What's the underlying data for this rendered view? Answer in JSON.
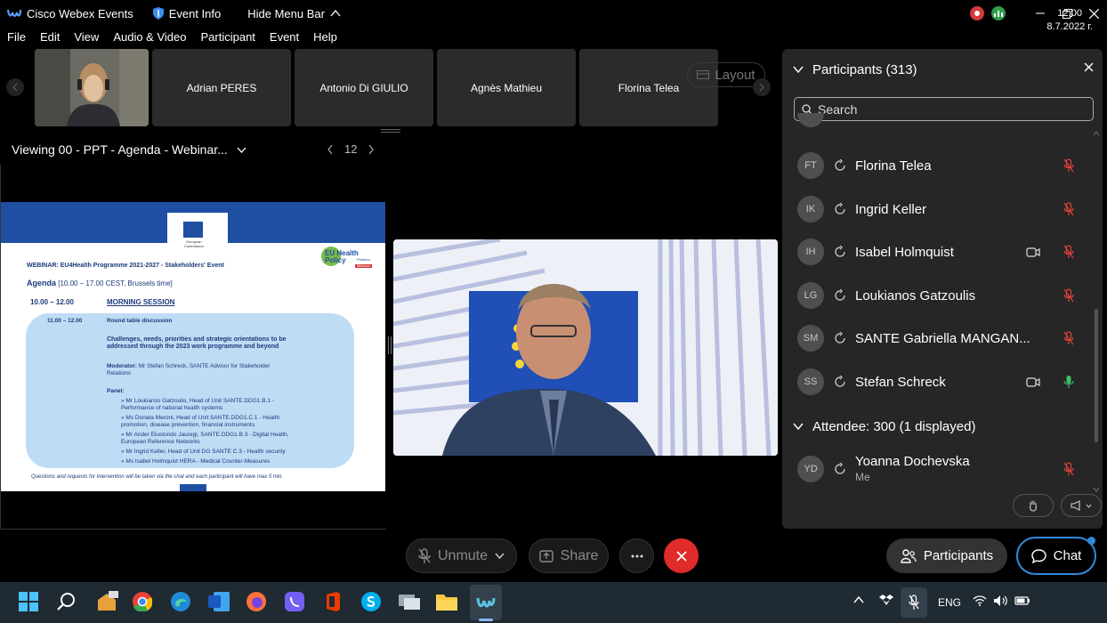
{
  "titlebar": {
    "app_name": "Cisco Webex Events",
    "event_info": "Event Info",
    "hide_menu": "Hide Menu Bar"
  },
  "menu": [
    "File",
    "Edit",
    "View",
    "Audio & Video",
    "Participant",
    "Event",
    "Help"
  ],
  "video_strip": {
    "tiles": [
      "Adrian PERES",
      "Antonio Di GIULIO",
      "Agnès Mathieu",
      "Florina Telea"
    ],
    "layout_label": "Layout"
  },
  "viewing": {
    "label": "Viewing 00 - PPT - Agenda - Webinar...",
    "page": "12"
  },
  "slide": {
    "ec_caption": "European Commission",
    "logo_title": "EU Health Policy",
    "logo_platform": "Platform",
    "logo_badge": "Webinars",
    "webinar": "WEBINAR: EU4Health Programme 2021-2027 - Stakeholders' Event",
    "agenda_label": "Agenda",
    "agenda_time": "[10.00 – 17.00 CEST, Brussels time]",
    "session_time": "10.00 – 12.00",
    "session_name": "MORNING SESSION",
    "round_time": "11.00 – 12.00",
    "round_title": "Round table discussion",
    "challenges_1": "Challenges, needs, priorities and strategic orientations to be",
    "challenges_2": "addressed through the 2023 work programme and beyond",
    "moderator_label": "Moderator:",
    "moderator_1": " Mr Stefan Schreck, SANTE Advisor for Stakeholder",
    "moderator_2": "Relations",
    "panel_label": "Panel:",
    "panel": [
      "» Mr Loukianos Gatzoulis, Head of Unit SANTE.DDG1.B.1 -",
      "   Performance of national health systems",
      "» Ms Donata Meroni, Head of Unit SANTE.DDG1.C.1 - Health",
      "   promotion, disease prevention, financial instruments",
      "» Mr Ander Elustondo Jauregi, SANTE.DDG1.B.3 - Digital Health,",
      "   European Reference Networks",
      "» Mr Ingrid Keller, Head of Unit DG SANTE C.3 - Health security",
      "» Ms Isabel Holmquist HERA - Medical Counter-Measures"
    ],
    "footer": "Questions and requests for intervention will be taken via the chat and each participant will have max 5 min."
  },
  "controls": {
    "unmute": "Unmute",
    "share": "Share",
    "participants": "Participants",
    "chat": "Chat"
  },
  "panel": {
    "title": "Participants (313)",
    "search_placeholder": "Search",
    "participants": [
      {
        "initials": "FT",
        "name": "Florina Telea",
        "video": false,
        "mic": "muted"
      },
      {
        "initials": "IK",
        "name": "Ingrid Keller",
        "video": false,
        "mic": "muted"
      },
      {
        "initials": "IH",
        "name": "Isabel Holmquist",
        "video": true,
        "mic": "muted"
      },
      {
        "initials": "LG",
        "name": "Loukianos Gatzoulis",
        "video": false,
        "mic": "muted"
      },
      {
        "initials": "SM",
        "name": "SANTE Gabriella MANGAN...",
        "video": false,
        "mic": "muted"
      },
      {
        "initials": "SS",
        "name": "Stefan Schreck",
        "video": true,
        "mic": "active"
      }
    ],
    "attendee_section": "Attendee: 300 (1 displayed)",
    "attendee": {
      "initials": "YD",
      "name": "Yoanna Dochevska",
      "sub": "Me"
    }
  },
  "taskbar": {
    "language": "ENG",
    "time": "12:00",
    "date": "8.7.2022 г."
  },
  "colors": {
    "accent": "#2f8bd8",
    "end_call": "#e02b2b",
    "muted_mic": "#e0443a",
    "active_mic": "#3cc36b",
    "panel_bg": "#262626"
  }
}
